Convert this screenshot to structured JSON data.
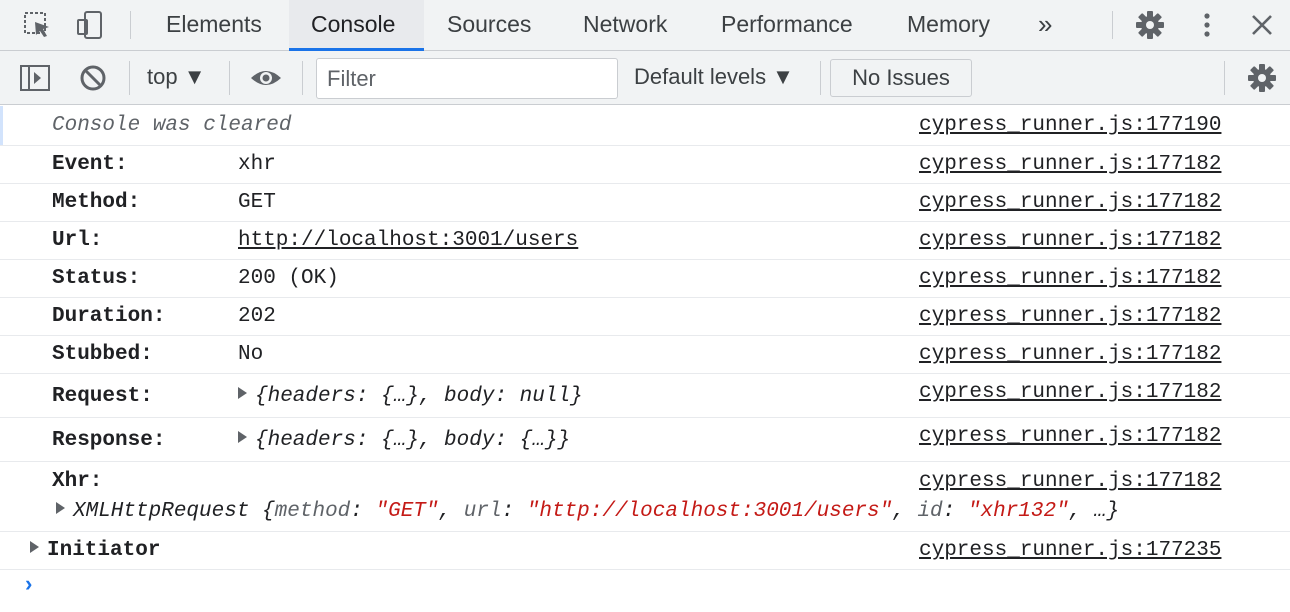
{
  "tabs": [
    {
      "label": "Elements"
    },
    {
      "label": "Console"
    },
    {
      "label": "Sources"
    },
    {
      "label": "Network"
    },
    {
      "label": "Performance"
    },
    {
      "label": "Memory"
    }
  ],
  "more_tabs": "»",
  "toolbar": {
    "context": "top ▼",
    "filter_placeholder": "Filter",
    "levels": "Default levels ▼",
    "issues": "No Issues"
  },
  "log": {
    "cleared": "Console was cleared",
    "cleared_src": "cypress_runner.js:177190",
    "rows": [
      {
        "key": "Event:",
        "value": "xhr",
        "src": "cypress_runner.js:177182"
      },
      {
        "key": "Method:",
        "value": "GET",
        "src": "cypress_runner.js:177182"
      },
      {
        "key": "Url:",
        "value": "http://localhost:3001/users",
        "src": "cypress_runner.js:177182"
      },
      {
        "key": "Status:",
        "value": "200 (OK)",
        "src": "cypress_runner.js:177182"
      },
      {
        "key": "Duration:",
        "value": "202",
        "src": "cypress_runner.js:177182"
      },
      {
        "key": "Stubbed:",
        "value": "No",
        "src": "cypress_runner.js:177182"
      },
      {
        "key": "Request:",
        "value": "{headers: {…}, body: null}",
        "src": "cypress_runner.js:177182"
      },
      {
        "key": "Response:",
        "value": "{headers: {…}, body: {…}}",
        "src": "cypress_runner.js:177182"
      },
      {
        "key": "Xhr:",
        "value": "",
        "src": "cypress_runner.js:177182"
      }
    ],
    "xhr_object": {
      "class": "XMLHttpRequest",
      "method": "\"GET\"",
      "url": "\"http://localhost:3001/users\"",
      "id": "\"xhr132\""
    },
    "initiator": "Initiator",
    "initiator_src": "cypress_runner.js:177235",
    "prompt": "›"
  },
  "colors": {
    "accent": "#1a73e8",
    "string": "#c41a16",
    "number": "#1a1aa6"
  }
}
